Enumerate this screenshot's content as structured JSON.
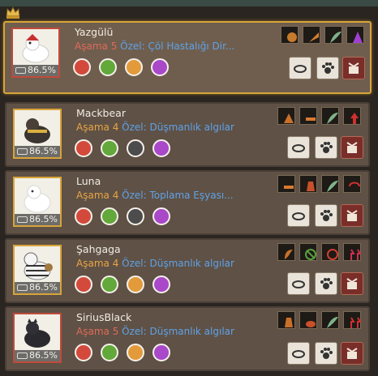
{
  "pets": [
    {
      "name": "Yazgülü",
      "stage_label": "Aşama",
      "stage_level": "5",
      "special_label": "Özel:",
      "special_text": "Çöl Hastalığı Dir...",
      "percent": "86.5%",
      "tier": "red"
    },
    {
      "name": "Mackbear",
      "stage_label": "Aşama",
      "stage_level": "4",
      "special_label": "Özel:",
      "special_text": "Düşmanlık algılar",
      "percent": "86.5%",
      "tier": "gold"
    },
    {
      "name": "Luna",
      "stage_label": "Aşama",
      "stage_level": "4",
      "special_label": "Özel:",
      "special_text": "Toplama Eşyası...",
      "percent": "86.5%",
      "tier": "gold"
    },
    {
      "name": "Şahgaga",
      "stage_label": "Aşama",
      "stage_level": "4",
      "special_label": "Özel:",
      "special_text": "Düşmanlık algılar",
      "percent": "86.5%",
      "tier": "gold"
    },
    {
      "name": "SiriusBlack",
      "stage_label": "Aşama",
      "stage_level": "5",
      "special_label": "Özel:",
      "special_text": "Düşmanlık algılar",
      "percent": "86.5%",
      "tier": "red"
    }
  ],
  "icons": {
    "crown": "crown-icon",
    "feed": "food-bowl-icon",
    "paw": "paw-icon",
    "box": "gift-box-icon",
    "circle1": "running-icon",
    "circle2": "hand-icon",
    "circle3": "compass-icon",
    "circle4": "figure-icon"
  },
  "colors": {
    "gold_frame": "#d8a43a",
    "red_frame": "#c04a3a",
    "stage_gold": "#e8a545",
    "stage_red": "#e06a5a",
    "special_blue": "#5fa2e8"
  }
}
